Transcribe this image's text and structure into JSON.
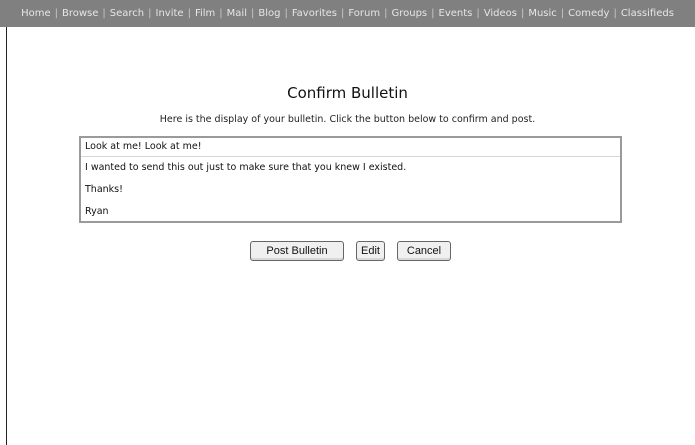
{
  "nav": {
    "items": [
      "Home",
      "Browse",
      "Search",
      "Invite",
      "Film",
      "Mail",
      "Blog",
      "Favorites",
      "Forum",
      "Groups",
      "Events",
      "Videos",
      "Music",
      "Comedy",
      "Classifieds"
    ],
    "separator": "|"
  },
  "page": {
    "title": "Confirm Bulletin",
    "subtitle": "Here is the display of your bulletin. Click the button below to confirm and post."
  },
  "bulletin": {
    "subject": "Look at me! Look at me!",
    "body_lines": [
      "I wanted to send this out just to make sure that you knew I existed.",
      "Thanks!",
      "Ryan"
    ]
  },
  "buttons": {
    "post": "Post Bulletin",
    "edit": "Edit",
    "cancel": "Cancel"
  },
  "colors": {
    "navbar_bg": "#808080",
    "nav_text": "#e6e6e6",
    "box_border": "#9a9a9a"
  }
}
